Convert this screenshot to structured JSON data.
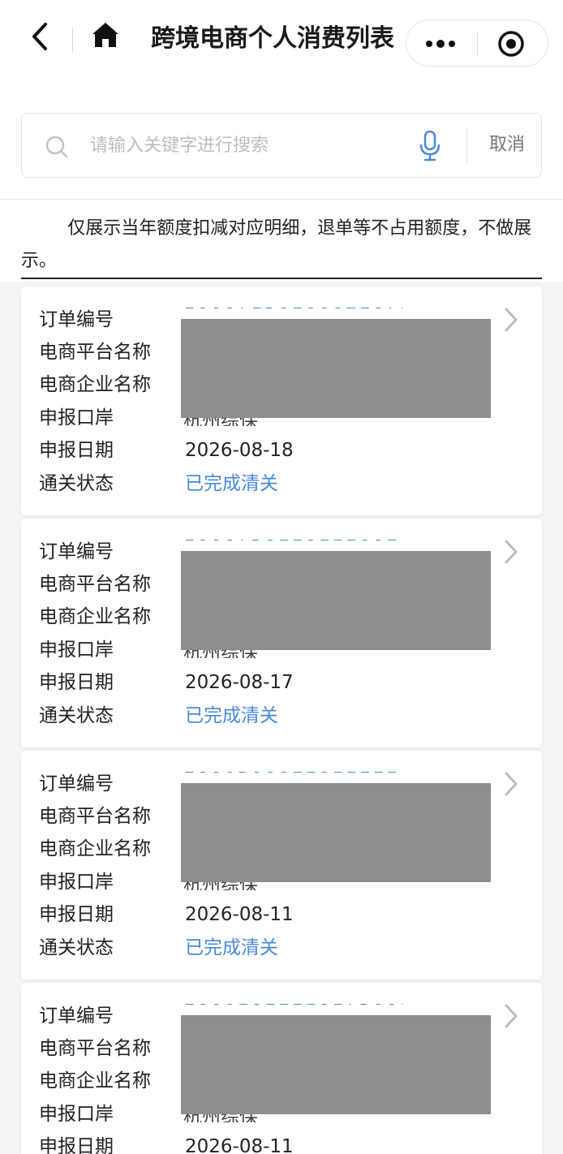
{
  "nav": {
    "title": "跨境电商个人消费列表"
  },
  "search": {
    "placeholder": "请输入关键字进行搜索",
    "cancel_label": "取消"
  },
  "notice": {
    "text": "仅展示当年额度扣减对应明细，退单等不占用额度，不做展示。"
  },
  "labels": {
    "order_no": "订单编号",
    "platform": "电商平台名称",
    "company": "电商企业名称",
    "port": "申报口岸",
    "date": "申报日期",
    "status": "通关状态"
  },
  "orders": [
    {
      "order_no_partial": "1000715010002107155",
      "port_partial": "杭州综保",
      "date": "2026-08-18",
      "status": "已完成清关"
    },
    {
      "order_no_partial": "1000750110111001707",
      "port_partial": "杭州综保",
      "date": "2026-08-17",
      "status": "已完成清关"
    },
    {
      "order_no_partial": "1000500011011111001",
      "port_partial": "杭州综保",
      "date": "2026-08-11",
      "status": "已完成清关"
    },
    {
      "order_no_partial": "1000101111017500100",
      "port_partial": "杭州综保",
      "date": "2026-08-11",
      "status": ""
    }
  ],
  "colors": {
    "link_blue": "#4a8ad9",
    "mask_gray": "#8e8e8e",
    "background": "#f5f5f7"
  }
}
